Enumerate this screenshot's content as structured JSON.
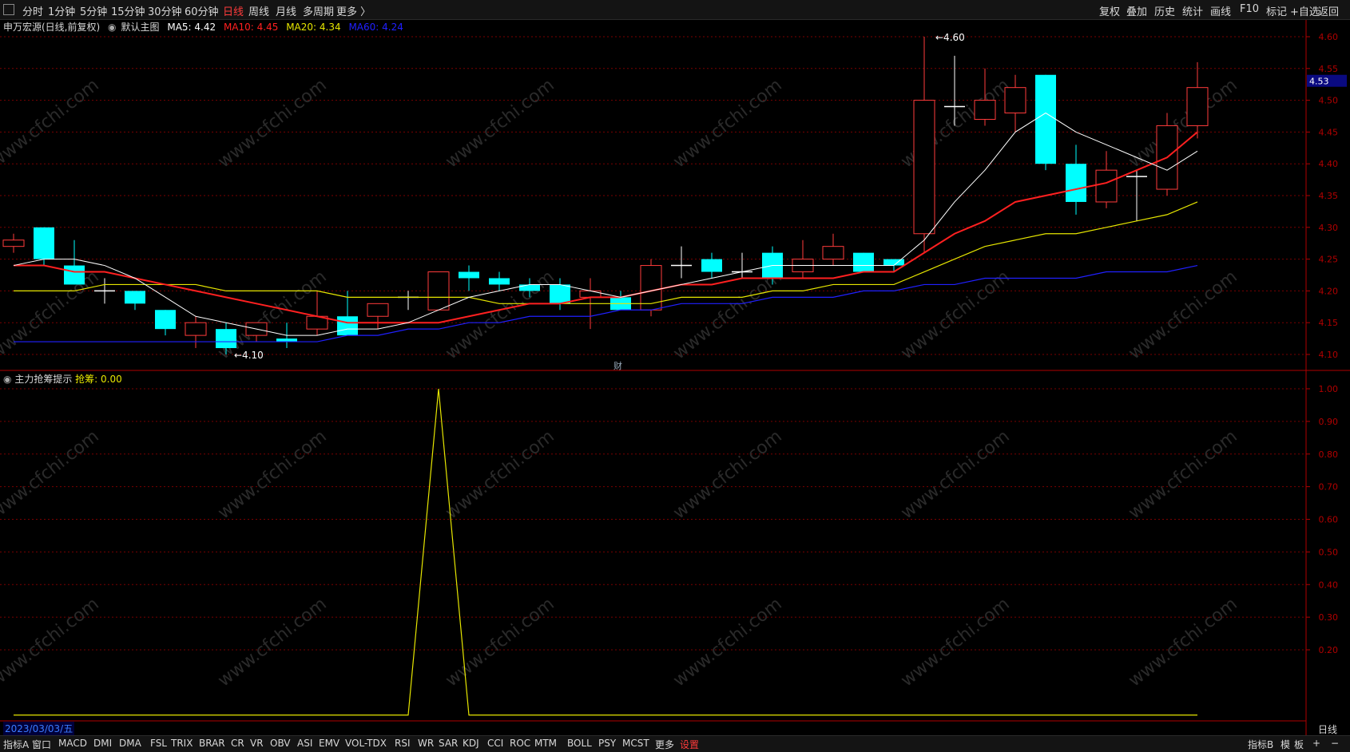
{
  "toolbar": {
    "periods": [
      "分时",
      "1分钟",
      "5分钟",
      "15分钟",
      "30分钟",
      "60分钟",
      "日线",
      "周线",
      "月线",
      "多周期",
      "更多 〉"
    ],
    "active_period": "日线",
    "right_buttons": [
      "复权",
      "叠加",
      "历史",
      "统计",
      "画线",
      "F10",
      "标记",
      "+自选",
      "返回"
    ]
  },
  "legend": {
    "stock": "申万宏源(日线,前复权)",
    "template": "默认主图",
    "ma5": "MA5: 4.42",
    "ma10": "MA10: 4.45",
    "ma20": "MA20: 4.34",
    "ma60": "MA60: 4.24"
  },
  "colors": {
    "up": "#ff3b3b",
    "down": "#00ffff",
    "ma5": "#ffffff",
    "ma10": "#ff2020",
    "ma20": "#e6e600",
    "ma60": "#2020ff",
    "grid": "#7a0000",
    "axis": "#b00000",
    "indicator": "#e6e600"
  },
  "indicator_legend": {
    "name": "主力抢筹提示",
    "series_label": "抢筹: 0.00"
  },
  "price_axis": {
    "ticks": [
      "4.60",
      "4.55",
      "4.50",
      "4.45",
      "4.40",
      "4.35",
      "4.30",
      "4.25",
      "4.20",
      "4.15",
      "4.10"
    ],
    "current_price": "4.53"
  },
  "indicator_axis": {
    "ticks": [
      "1.00",
      "0.90",
      "0.80",
      "0.70",
      "0.60",
      "0.50",
      "0.40",
      "0.30",
      "0.20"
    ]
  },
  "annotations": {
    "high": "4.60",
    "low": "4.10",
    "finance_mark": "财"
  },
  "watermark": "www.cfchi.com",
  "chart_data": {
    "type": "candlestick",
    "price_range": [
      4.08,
      4.62
    ],
    "indicator_range": [
      0.0,
      1.1
    ],
    "candles": [
      {
        "o": 4.27,
        "c": 4.28,
        "h": 4.29,
        "l": 4.26
      },
      {
        "o": 4.3,
        "c": 4.25,
        "h": 4.3,
        "l": 4.24
      },
      {
        "o": 4.24,
        "c": 4.21,
        "h": 4.28,
        "l": 4.21
      },
      {
        "o": 4.2,
        "c": 4.2,
        "h": 4.22,
        "l": 4.18
      },
      {
        "o": 4.2,
        "c": 4.18,
        "h": 4.2,
        "l": 4.17
      },
      {
        "o": 4.17,
        "c": 4.14,
        "h": 4.17,
        "l": 4.13
      },
      {
        "o": 4.13,
        "c": 4.15,
        "h": 4.16,
        "l": 4.11
      },
      {
        "o": 4.14,
        "c": 4.11,
        "h": 4.15,
        "l": 4.1
      },
      {
        "o": 4.13,
        "c": 4.15,
        "h": 4.15,
        "l": 4.12
      },
      {
        "o": 4.125,
        "c": 4.12,
        "h": 4.15,
        "l": 4.11
      },
      {
        "o": 4.14,
        "c": 4.16,
        "h": 4.2,
        "l": 4.13
      },
      {
        "o": 4.16,
        "c": 4.13,
        "h": 4.2,
        "l": 4.13
      },
      {
        "o": 4.16,
        "c": 4.18,
        "h": 4.18,
        "l": 4.14
      },
      {
        "o": 4.19,
        "c": 4.19,
        "h": 4.2,
        "l": 4.17
      },
      {
        "o": 4.17,
        "c": 4.23,
        "h": 4.23,
        "l": 4.17
      },
      {
        "o": 4.23,
        "c": 4.22,
        "h": 4.24,
        "l": 4.2
      },
      {
        "o": 4.22,
        "c": 4.21,
        "h": 4.23,
        "l": 4.2
      },
      {
        "o": 4.21,
        "c": 4.2,
        "h": 4.22,
        "l": 4.19
      },
      {
        "o": 4.21,
        "c": 4.18,
        "h": 4.22,
        "l": 4.17
      },
      {
        "o": 4.19,
        "c": 4.2,
        "h": 4.22,
        "l": 4.14
      },
      {
        "o": 4.19,
        "c": 4.17,
        "h": 4.2,
        "l": 4.17
      },
      {
        "o": 4.17,
        "c": 4.24,
        "h": 4.25,
        "l": 4.16
      },
      {
        "o": 4.24,
        "c": 4.24,
        "h": 4.27,
        "l": 4.22
      },
      {
        "o": 4.25,
        "c": 4.23,
        "h": 4.26,
        "l": 4.22
      },
      {
        "o": 4.23,
        "c": 4.23,
        "h": 4.26,
        "l": 4.22
      },
      {
        "o": 4.26,
        "c": 4.22,
        "h": 4.27,
        "l": 4.21
      },
      {
        "o": 4.23,
        "c": 4.25,
        "h": 4.28,
        "l": 4.22
      },
      {
        "o": 4.25,
        "c": 4.27,
        "h": 4.29,
        "l": 4.24
      },
      {
        "o": 4.26,
        "c": 4.23,
        "h": 4.26,
        "l": 4.23
      },
      {
        "o": 4.25,
        "c": 4.24,
        "h": 4.25,
        "l": 4.23
      },
      {
        "o": 4.29,
        "c": 4.5,
        "h": 4.6,
        "l": 4.26
      },
      {
        "o": 4.49,
        "c": 4.49,
        "h": 4.57,
        "l": 4.46
      },
      {
        "o": 4.47,
        "c": 4.5,
        "h": 4.55,
        "l": 4.46
      },
      {
        "o": 4.48,
        "c": 4.52,
        "h": 4.54,
        "l": 4.45
      },
      {
        "o": 4.54,
        "c": 4.4,
        "h": 4.54,
        "l": 4.39
      },
      {
        "o": 4.4,
        "c": 4.34,
        "h": 4.43,
        "l": 4.32
      },
      {
        "o": 4.34,
        "c": 4.39,
        "h": 4.42,
        "l": 4.33
      },
      {
        "o": 4.38,
        "c": 4.38,
        "h": 4.39,
        "l": 4.31
      },
      {
        "o": 4.36,
        "c": 4.46,
        "h": 4.48,
        "l": 4.35
      },
      {
        "o": 4.46,
        "c": 4.52,
        "h": 4.56,
        "l": 4.44
      }
    ],
    "ma5": [
      4.24,
      4.25,
      4.25,
      4.24,
      4.22,
      4.19,
      4.16,
      4.15,
      4.14,
      4.13,
      4.13,
      4.14,
      4.14,
      4.15,
      4.17,
      4.19,
      4.2,
      4.21,
      4.21,
      4.2,
      4.19,
      4.2,
      4.21,
      4.22,
      4.23,
      4.24,
      4.24,
      4.24,
      4.24,
      4.24,
      4.28,
      4.34,
      4.39,
      4.45,
      4.48,
      4.45,
      4.43,
      4.41,
      4.39,
      4.42
    ],
    "ma10": [
      4.24,
      4.24,
      4.23,
      4.23,
      4.22,
      4.21,
      4.2,
      4.19,
      4.18,
      4.17,
      4.16,
      4.15,
      4.15,
      4.15,
      4.15,
      4.16,
      4.17,
      4.18,
      4.18,
      4.19,
      4.19,
      4.2,
      4.21,
      4.21,
      4.22,
      4.22,
      4.22,
      4.22,
      4.23,
      4.23,
      4.26,
      4.29,
      4.31,
      4.34,
      4.35,
      4.36,
      4.37,
      4.39,
      4.41,
      4.45
    ],
    "ma20": [
      4.2,
      4.2,
      4.2,
      4.21,
      4.21,
      4.21,
      4.21,
      4.2,
      4.2,
      4.2,
      4.2,
      4.19,
      4.19,
      4.19,
      4.19,
      4.19,
      4.18,
      4.18,
      4.18,
      4.18,
      4.18,
      4.18,
      4.19,
      4.19,
      4.19,
      4.2,
      4.2,
      4.21,
      4.21,
      4.21,
      4.23,
      4.25,
      4.27,
      4.28,
      4.29,
      4.29,
      4.3,
      4.31,
      4.32,
      4.34
    ],
    "ma60": [
      4.12,
      4.12,
      4.12,
      4.12,
      4.12,
      4.12,
      4.12,
      4.12,
      4.12,
      4.12,
      4.12,
      4.13,
      4.13,
      4.14,
      4.14,
      4.15,
      4.15,
      4.16,
      4.16,
      4.16,
      4.17,
      4.17,
      4.18,
      4.18,
      4.18,
      4.19,
      4.19,
      4.19,
      4.2,
      4.2,
      4.21,
      4.21,
      4.22,
      4.22,
      4.22,
      4.22,
      4.23,
      4.23,
      4.23,
      4.24
    ],
    "indicator": [
      0,
      0,
      0,
      0,
      0,
      0,
      0,
      0,
      0,
      0,
      0,
      0,
      0,
      0,
      1,
      0,
      0,
      0,
      0,
      0,
      0,
      0,
      0,
      0,
      0,
      0,
      0,
      0,
      0,
      0,
      0,
      0,
      0,
      0,
      0,
      0,
      0,
      0,
      0,
      0
    ]
  },
  "bottom": {
    "date": "2023/03/03/五",
    "period_label": "日线",
    "tabs": [
      "指标A",
      "窗口",
      "MACD",
      "DMI",
      "DMA",
      "FSL",
      "TRIX",
      "BRAR",
      "CR",
      "VR",
      "OBV",
      "ASI",
      "EMV",
      "VOL-TDX",
      "RSI",
      "WR",
      "SAR",
      "KDJ",
      "CCI",
      "ROC",
      "MTM",
      "BOLL",
      "PSY",
      "MCST",
      "更多",
      "设置"
    ],
    "right_tabs": [
      "指标B",
      "模",
      "板",
      "+",
      "−"
    ]
  }
}
